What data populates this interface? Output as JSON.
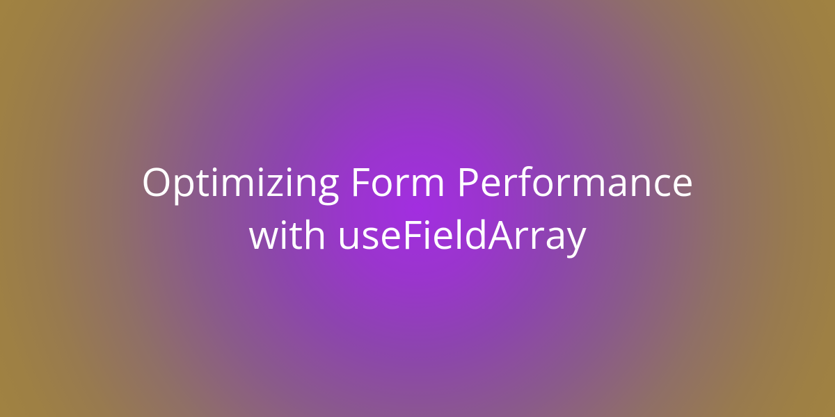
{
  "hero": {
    "title_line1": "Optimizing Form Performance",
    "title_line2": "with useFieldArray",
    "text_color": "#ffffff",
    "gradient_center": "#a22ee0",
    "gradient_edge": "#a08241"
  }
}
